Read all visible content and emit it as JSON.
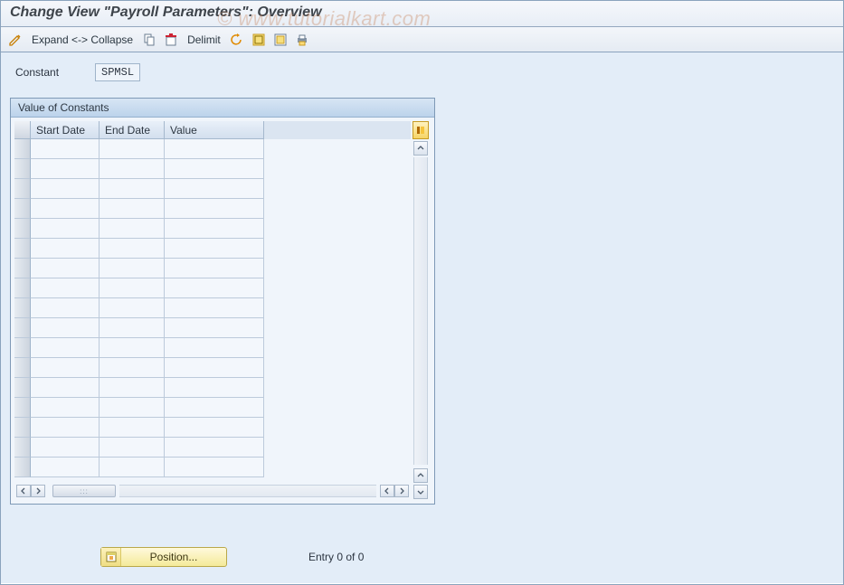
{
  "header": {
    "title": "Change View \"Payroll Parameters\": Overview"
  },
  "toolbar": {
    "expand_collapse": "Expand <-> Collapse",
    "delimit": "Delimit"
  },
  "field": {
    "label": "Constant",
    "value": "SPMSL"
  },
  "panel": {
    "title": "Value of Constants",
    "columns": {
      "start": "Start Date",
      "end": "End Date",
      "value": "Value"
    }
  },
  "footer": {
    "position": "Position...",
    "entry_status": "Entry 0 of 0"
  },
  "watermark": "© www.tutorialkart.com"
}
